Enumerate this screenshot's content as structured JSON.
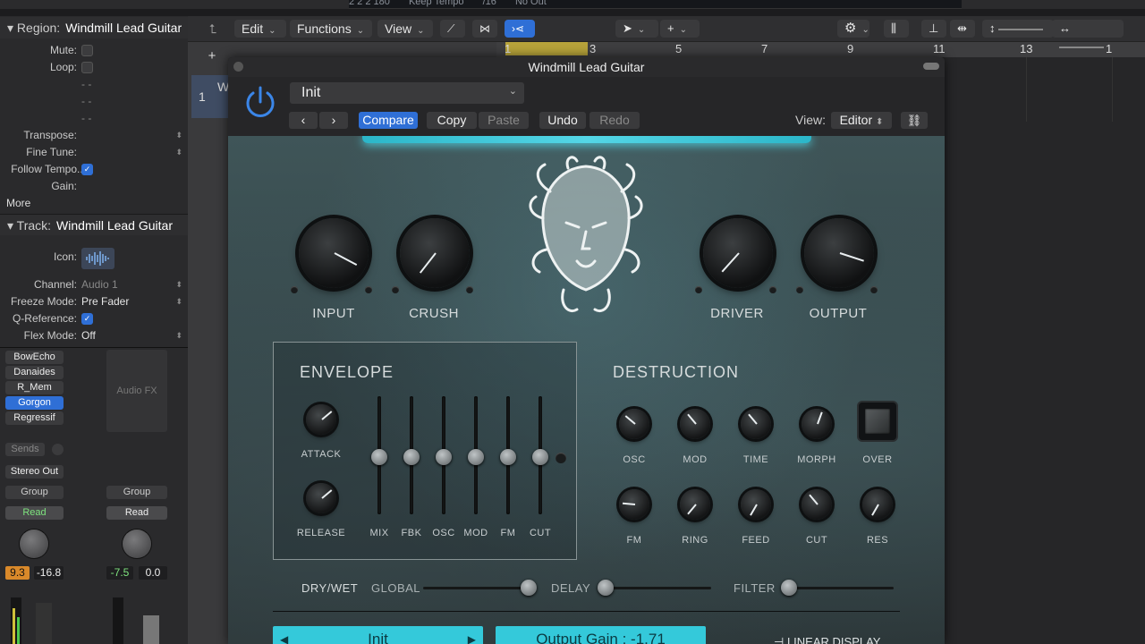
{
  "lcd": {
    "position": "2  2  2  180",
    "tempo_mode": "Keep Tempo",
    "signature": "/16",
    "no_out": "No Out"
  },
  "toolbar": {
    "edit": "Edit",
    "functions": "Functions",
    "view": "View"
  },
  "inspector": {
    "region_header": "Region:",
    "region_name": "Windmill Lead Guitar",
    "mute_label": "Mute:",
    "loop_label": "Loop:",
    "dash1": "- -",
    "dash2": "- -",
    "dash3": "- -",
    "transpose_label": "Transpose:",
    "finetune_label": "Fine Tune:",
    "follow_tempo_label": "Follow Tempo...",
    "gain_label": "Gain:",
    "more_label": "More",
    "track_header": "Track:",
    "track_name": "Windmill Lead Guitar",
    "icon_label": "Icon:",
    "channel_label": "Channel:",
    "channel_value": "Audio 1",
    "freeze_label": "Freeze Mode:",
    "freeze_value": "Pre Fader",
    "qref_label": "Q-Reference:",
    "flex_label": "Flex Mode:",
    "flex_value": "Off",
    "plugins": [
      "BowEcho",
      "Danaides",
      "R_Mem",
      "Gorgon",
      "Regressif"
    ],
    "audio_fx_label": "Audio FX",
    "sends_label": "Sends",
    "output_label": "Stereo Out",
    "group_label": "Group",
    "read_label": "Read",
    "vol1": "9.3",
    "pan1": "-16.8",
    "vol2": "-7.5",
    "pan2": "0.0"
  },
  "arrange": {
    "track_number": "1",
    "region_short": "W",
    "ruler": [
      "1",
      "3",
      "5",
      "7",
      "9",
      "11",
      "13",
      "1"
    ]
  },
  "plugin": {
    "window_title": "Windmill Lead Guitar",
    "preset": "Init",
    "compare": "Compare",
    "copy": "Copy",
    "paste": "Paste",
    "undo": "Undo",
    "redo": "Redo",
    "view_label": "View:",
    "view_value": "Editor",
    "knobs": {
      "input": "INPUT",
      "crush": "CRUSH",
      "driver": "DRIVER",
      "output": "OUTPUT"
    },
    "envelope": {
      "title": "ENVELOPE",
      "attack": "ATTACK",
      "release": "RELEASE",
      "faders": [
        "MIX",
        "FBK",
        "OSC",
        "MOD",
        "FM",
        "CUT"
      ]
    },
    "destruction": {
      "title": "DESTRUCTION",
      "row1": [
        "OSC",
        "MOD",
        "TIME",
        "MORPH",
        "OVER"
      ],
      "row2": [
        "FM",
        "RING",
        "FEED",
        "CUT",
        "RES"
      ]
    },
    "drywet": {
      "label": "DRY/WET",
      "global": "GLOBAL",
      "delay": "DELAY",
      "filter": "FILTER"
    },
    "bottom": {
      "preset": "Init",
      "output_gain": "Output Gain : -1.71",
      "linear": "LINEAR DISPLAY"
    }
  },
  "colors": {
    "accent_blue": "#2f6fd6",
    "cyan": "#34c9da",
    "read_green": "#7ee37e",
    "cycle_yellow": "#b6a23a"
  }
}
